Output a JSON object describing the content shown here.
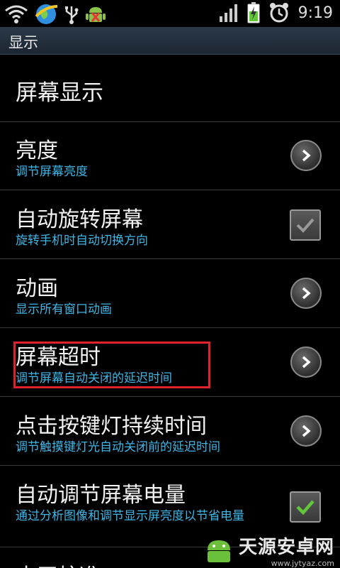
{
  "status_bar": {
    "time": "9:19",
    "icons": [
      "wifi-icon",
      "browser-globe-icon",
      "usb-icon",
      "android-debug-icon",
      "signal-bars-icon",
      "battery-charging-icon",
      "alarm-clock-icon"
    ]
  },
  "titlebar": {
    "title": "显示"
  },
  "section_header": "屏幕显示",
  "rows": [
    {
      "title": "亮度",
      "subtitle": "调节屏幕亮度",
      "control": "chevron"
    },
    {
      "title": "自动旋转屏幕",
      "subtitle": "旋转手机时自动切换方向",
      "control": "checkbox",
      "checked": false
    },
    {
      "title": "动画",
      "subtitle": "显示所有窗口动画",
      "control": "chevron"
    },
    {
      "title": "屏幕超时",
      "subtitle": "调节屏幕自动关闭的延迟时间",
      "control": "chevron"
    },
    {
      "title": "点击按键灯持续时间",
      "subtitle": "调节触摸键灯光自动关闭前的延迟时间",
      "control": "chevron"
    },
    {
      "title": "自动调节屏幕电量",
      "subtitle": "通过分析图像和调节显示屏亮度以节省电量",
      "control": "checkbox",
      "checked": true
    }
  ],
  "partial_row": {
    "title": "水平校准"
  },
  "colors": {
    "subtitle": "#3fb6e6",
    "highlight": "#e0202a",
    "check_green": "#62c83a",
    "titlebar": "#1f2b36"
  },
  "watermark": {
    "name": "天源安卓网",
    "url": "www.jytyaz.com"
  }
}
